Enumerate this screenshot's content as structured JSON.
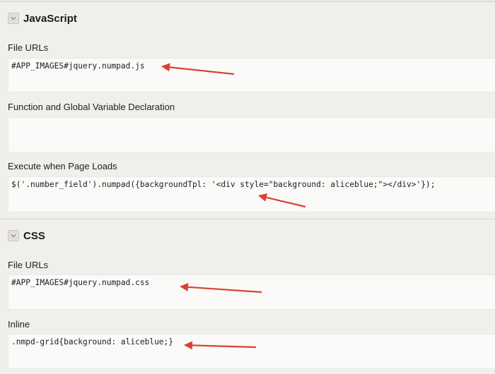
{
  "javascript": {
    "title": "JavaScript",
    "file_urls_label": "File URLs",
    "file_urls_value": "#APP_IMAGES#jquery.numpad.js",
    "function_decl_label": "Function and Global Variable Declaration",
    "function_decl_value": "",
    "page_load_label": "Execute when Page Loads",
    "page_load_value": "$('.number_field').numpad({backgroundTpl: '<div style=\"background: aliceblue;\"></div>'});"
  },
  "css": {
    "title": "CSS",
    "file_urls_label": "File URLs",
    "file_urls_value": "#APP_IMAGES#jquery.numpad.css",
    "inline_label": "Inline",
    "inline_value": ".nmpd-grid{background: aliceblue;}"
  },
  "annotations": {
    "arrow_color": "#d9432f"
  },
  "icons": {
    "collapse_toggle": "chevron-down-icon"
  }
}
